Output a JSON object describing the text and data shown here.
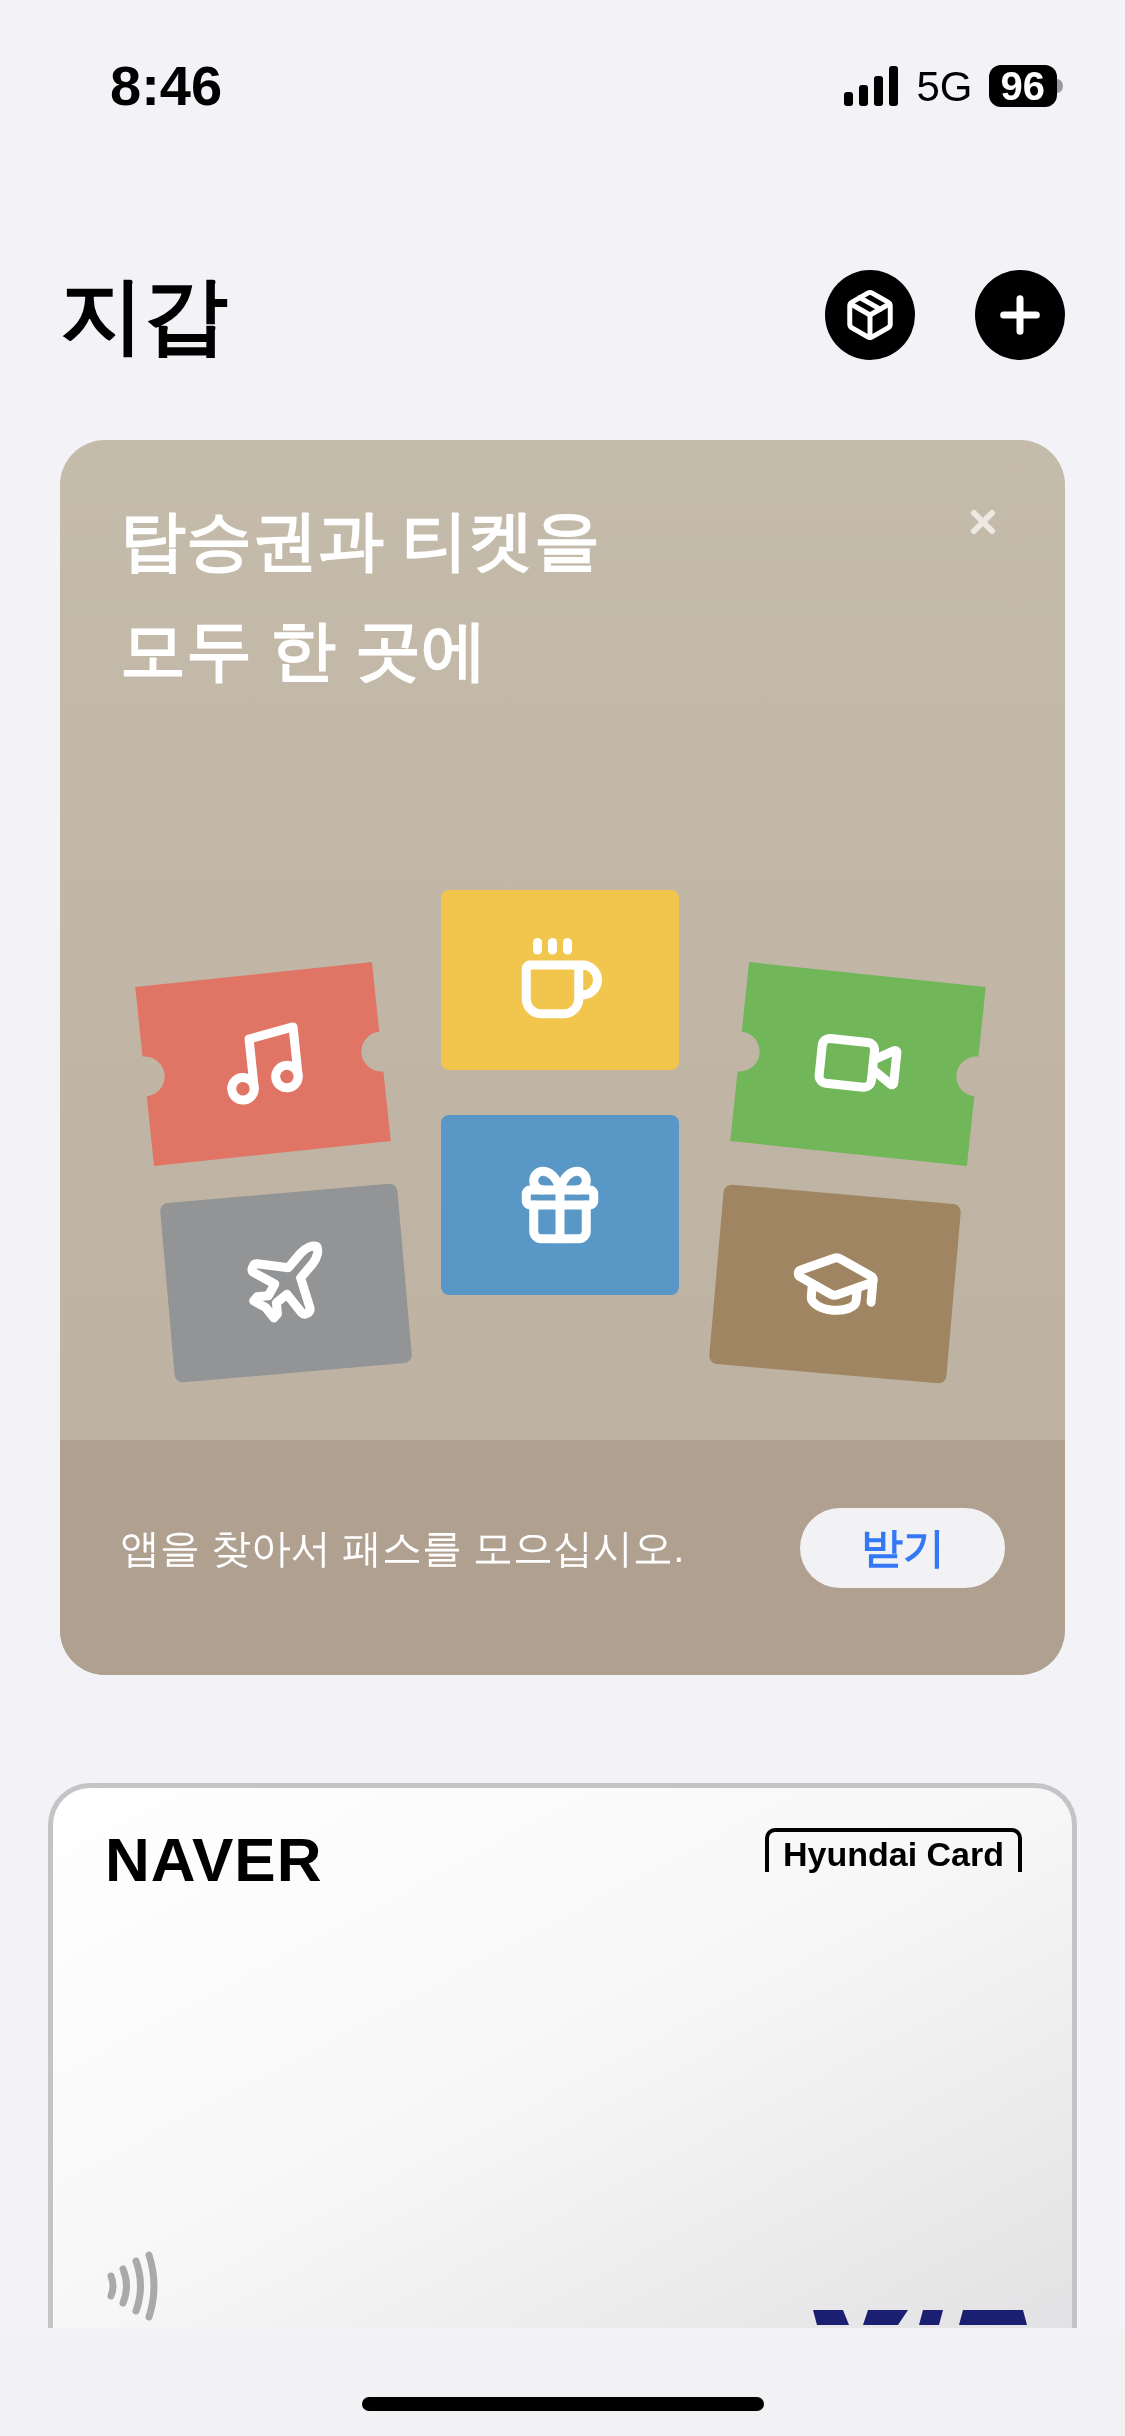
{
  "status_bar": {
    "time": "8:46",
    "network": "5G",
    "battery": "96"
  },
  "header": {
    "title": "지갑"
  },
  "promo": {
    "title_lines": [
      "탑승권과 티켓을",
      "모두 한 곳에"
    ],
    "tickets": [
      {
        "kind": "music",
        "color": "#e07565"
      },
      {
        "kind": "coffee",
        "color": "#f2c64c"
      },
      {
        "kind": "movie",
        "color": "#72b65a"
      },
      {
        "kind": "flight",
        "color": "#939496"
      },
      {
        "kind": "gift",
        "color": "#5997c6"
      },
      {
        "kind": "school",
        "color": "#9f8561"
      }
    ],
    "message": "앱을 찾아서 패스를 모으십시오.",
    "button": "받기"
  },
  "card": {
    "brand": "NAVER",
    "issuer": "Hyundai Card"
  }
}
